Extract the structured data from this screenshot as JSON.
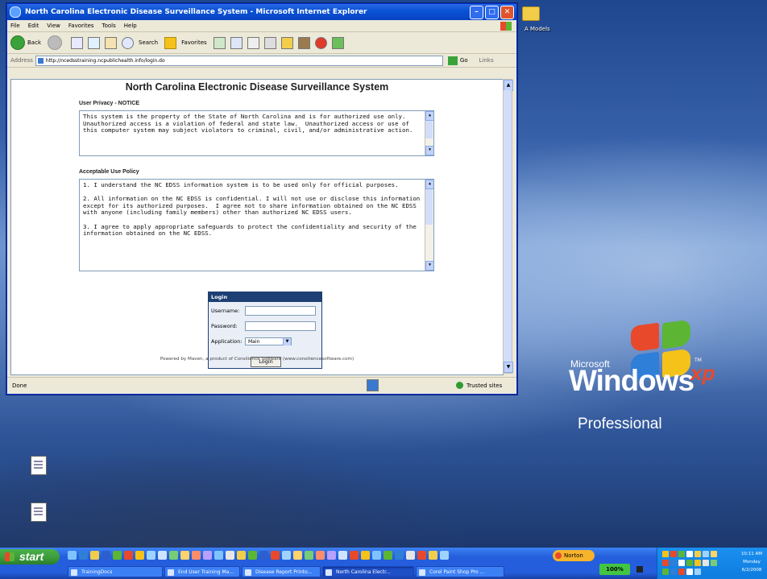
{
  "browser": {
    "title": "North Carolina Electronic Disease Surveillance System - Microsoft Internet Explorer",
    "menu": [
      "File",
      "Edit",
      "View",
      "Favorites",
      "Tools",
      "Help"
    ],
    "toolbar": {
      "back": "Back",
      "search": "Search",
      "favorites": "Favorites"
    },
    "address_label": "Address",
    "address_value": "http://ncedsstraining.ncpublichealth.info/login.do",
    "go_label": "Go",
    "links_label": "Links",
    "status_text": "Done",
    "zone_text": "Trusted sites"
  },
  "page": {
    "heading": "North Carolina Electronic Disease Surveillance System",
    "privacy_label": "User Privacy - NOTICE",
    "privacy_text": "This system is the property of the State of North Carolina and is for authorized use only. Unauthorized access is a violation of federal and state law.  Unauthorized access or use of this computer system may subject violators to criminal, civil, and/or administrative action.",
    "aup_label": "Acceptable Use Policy",
    "aup_items": [
      "1. I understand the NC EDSS information system is to be used only for official purposes.",
      "2. All information on the NC EDSS is confidential. I will not use or disclose this information except for its authorized purposes.  I agree not to share information obtained on the NC EDSS with anyone (including family members) other than authorized NC EDSS users.",
      "3. I agree to apply appropriate safeguards to protect the confidentiality and security of the information obtained on the NC EDSS."
    ],
    "login": {
      "header": "Login",
      "username_label": "Username:",
      "password_label": "Password:",
      "application_label": "Application:",
      "application_value": "Main",
      "button": "Login"
    },
    "powered_by": "Powered by Maven, a product of Consilience Software (www.consiliencesoftware.com)"
  },
  "desktop": {
    "corner_label": "A Models",
    "ms_label": "Microsoft",
    "windows_label": "Windows",
    "xp_label": "xp",
    "tm_label": "TM",
    "edition_label": "Professional"
  },
  "taskbar": {
    "start": "start",
    "tasks": [
      "TrainingDocs",
      "End User Training Ma...",
      "Disease Report Printo...",
      "North Carolina Electr...",
      "Corel Paint Shop Pro ..."
    ],
    "norton": "Norton",
    "zoom": "100%",
    "clock_time": "10:11 AM",
    "clock_day": "Monday",
    "clock_date": "6/2/2008"
  }
}
